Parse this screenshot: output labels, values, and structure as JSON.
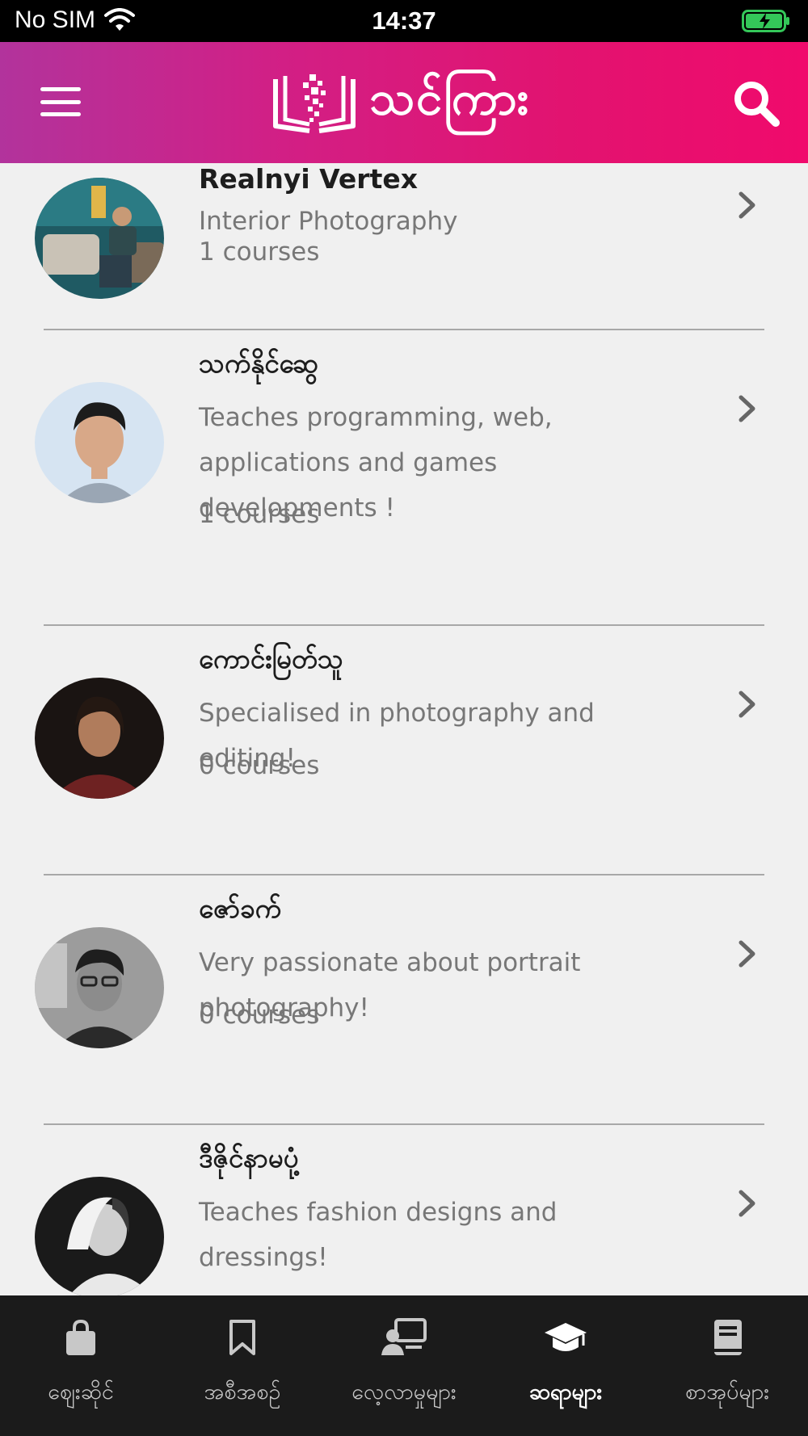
{
  "status_bar": {
    "carrier": "No SIM",
    "time": "14:37"
  },
  "header": {
    "logo_text": "သင်ကြား",
    "menu_icon": "hamburger-menu-icon",
    "search_icon": "search-icon",
    "gradient": [
      "#b2339c",
      "#f00a6c"
    ]
  },
  "teachers": [
    {
      "name": "Realnyi Vertex",
      "description": "Interior Photography",
      "courses": "1 courses"
    },
    {
      "name": "သက်နိုင်ဆွေ",
      "description": "Teaches programming, web, applications and games developments !",
      "courses": "1 courses"
    },
    {
      "name": "ကောင်းမြတ်သူ",
      "description": "Specialised in photography and editing!",
      "courses": "0 courses"
    },
    {
      "name": "ဇော်ခက်",
      "description": "Very passionate about portrait photography!",
      "courses": "0 courses"
    },
    {
      "name": "ဒီဇိုင်နာမပုံ့",
      "description": "Teaches fashion designs and dressings!",
      "courses": ""
    }
  ],
  "bottom_nav": {
    "items": [
      {
        "label": "ဈေးဆိုင်",
        "icon": "shopping-bag-icon",
        "active": false
      },
      {
        "label": "အစီအစဉ်",
        "icon": "bookmark-icon",
        "active": false
      },
      {
        "label": "လေ့လာမှုများ",
        "icon": "presentation-icon",
        "active": false
      },
      {
        "label": "ဆရာများ",
        "icon": "graduation-cap-icon",
        "active": true
      },
      {
        "label": "စာအုပ်များ",
        "icon": "book-icon",
        "active": false
      }
    ]
  }
}
